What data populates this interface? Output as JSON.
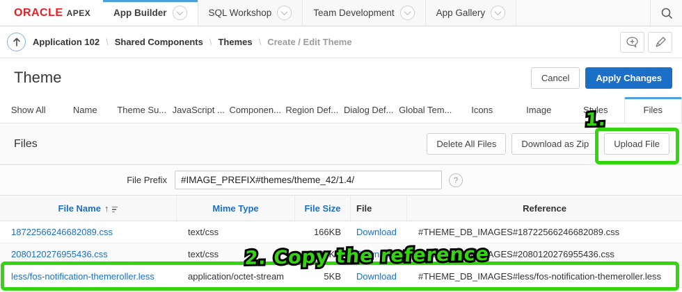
{
  "nav": {
    "brand": {
      "oracle": "ORACLE",
      "apex": "APEX"
    },
    "tabs": [
      {
        "label": "App Builder"
      },
      {
        "label": "SQL Workshop"
      },
      {
        "label": "Team Development"
      },
      {
        "label": "App Gallery"
      }
    ]
  },
  "breadcrumb": {
    "separator": "\\",
    "items": [
      "Application 102",
      "Shared Components",
      "Themes",
      "Create / Edit Theme"
    ]
  },
  "page": {
    "title": "Theme",
    "cancel_label": "Cancel",
    "apply_label": "Apply Changes"
  },
  "section_tabs": [
    "Show All",
    "Name",
    "Theme Su...",
    "JavaScript ...",
    "Componen...",
    "Region Def...",
    "Dialog Def...",
    "Global Tem...",
    "Icons",
    "Image",
    "Styles",
    "Files"
  ],
  "files": {
    "title": "Files",
    "delete_all_label": "Delete All Files",
    "download_zip_label": "Download as Zip",
    "upload_label": "Upload File",
    "prefix_label": "File Prefix",
    "prefix_value": "#IMAGE_PREFIX#themes/theme_42/1.4/",
    "help_glyph": "?"
  },
  "table": {
    "headers": {
      "file_name": "File Name",
      "mime_type": "Mime Type",
      "file_size": "File Size",
      "file": "File",
      "reference": "Reference"
    },
    "rows": [
      {
        "file_name": "18722566246682089.css",
        "mime_type": "text/css",
        "file_size": "166KB",
        "file": "Download",
        "reference": "#THEME_DB_IMAGES#18722566246682089.css"
      },
      {
        "file_name": "2080120276955436.css",
        "mime_type": "text/css",
        "file_size": "144KB",
        "file": "Download",
        "reference": "#THEME_DB_IMAGES#2080120276955436.css"
      },
      {
        "file_name": "less/fos-notification-themeroller.less",
        "mime_type": "application/octet-stream",
        "file_size": "5KB",
        "file": "Download",
        "reference": "#THEME_DB_IMAGES#less/fos-notification-themeroller.less"
      }
    ]
  },
  "annotations": {
    "step1": "1.",
    "step2": "2. Copy the reference"
  },
  "colors": {
    "accent_blue": "#1b6fc7",
    "tab_indicator_blue": "#4ba0de",
    "oracle_red": "#ed1c24",
    "annotation_green": "#35d410"
  }
}
